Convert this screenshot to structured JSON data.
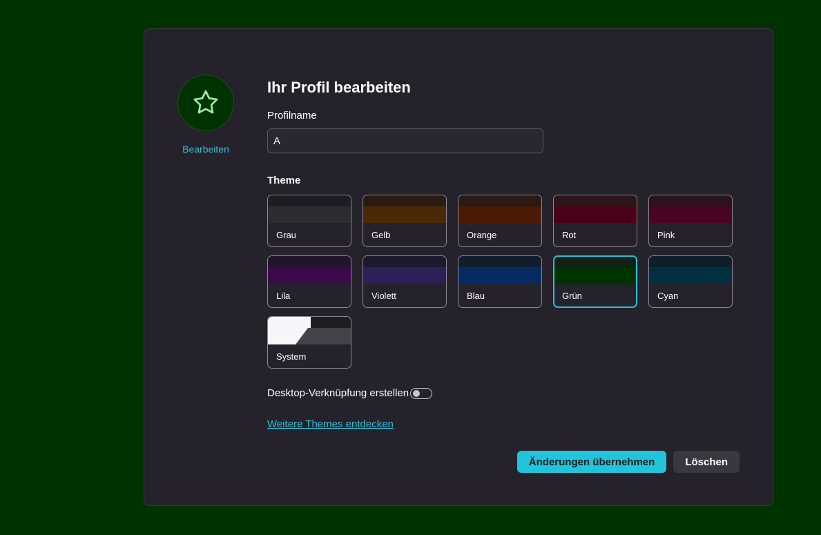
{
  "avatar": {
    "icon": "star-icon",
    "edit_label": "Bearbeiten",
    "icon_color": "#9cf0a0"
  },
  "form": {
    "title": "Ihr Profil bearbeiten",
    "profile_name_label": "Profilname",
    "profile_name_value": "A",
    "theme_label": "Theme",
    "desktop_shortcut_label": "Desktop-Verknüpfung erstellen",
    "desktop_shortcut_on": false,
    "more_themes_link": "Weitere Themes entdecken"
  },
  "themes": [
    {
      "name": "Grau",
      "top": "#1f1d22",
      "mid": "#2e2b33",
      "selected": false
    },
    {
      "name": "Gelb",
      "top": "#2b1c12",
      "mid": "#4a2a06",
      "selected": false
    },
    {
      "name": "Orange",
      "top": "#2b1a14",
      "mid": "#4a1a04",
      "selected": false
    },
    {
      "name": "Rot",
      "top": "#2b161c",
      "mid": "#4a0218",
      "selected": false
    },
    {
      "name": "Pink",
      "top": "#2b141e",
      "mid": "#4a0424",
      "selected": false
    },
    {
      "name": "Lila",
      "top": "#22142a",
      "mid": "#3c0a4a",
      "selected": false
    },
    {
      "name": "Violett",
      "top": "#1c1a2c",
      "mid": "#2e1e5a",
      "selected": false
    },
    {
      "name": "Blau",
      "top": "#111c2c",
      "mid": "#072a64",
      "selected": false
    },
    {
      "name": "Grün",
      "top": "#112214",
      "mid": "#003300",
      "selected": true
    },
    {
      "name": "Cyan",
      "top": "#101e28",
      "mid": "#023040",
      "selected": false
    }
  ],
  "system_theme": {
    "name": "System",
    "light": "#f6f6f8",
    "dark_top": "#1f1d22",
    "dark_mid": "#45424c"
  },
  "buttons": {
    "apply": "Änderungen übernehmen",
    "delete": "Löschen"
  },
  "colors": {
    "accent": "#22c4db",
    "background": "#003200",
    "dialog": "#25222b"
  }
}
